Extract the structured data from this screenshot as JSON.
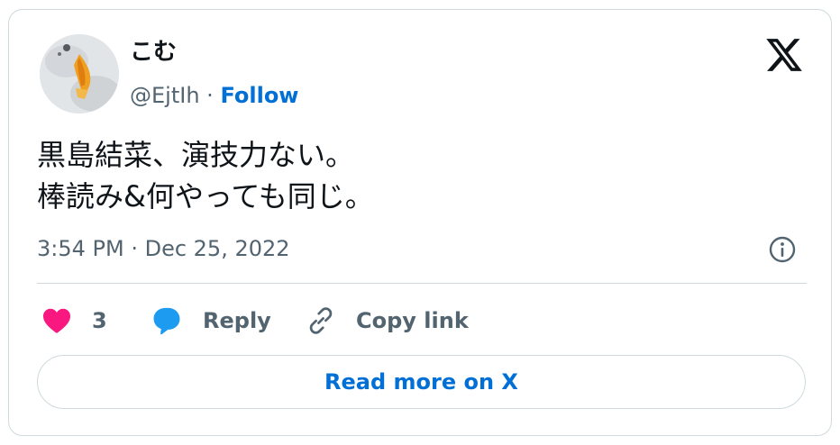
{
  "author": {
    "display_name": "こむ",
    "handle": "@EjtIh",
    "separator": "·",
    "follow_label": "Follow"
  },
  "tweet": {
    "lines": [
      "黒島結菜、演技力ない。",
      "棒読み&何やっても同じ。"
    ],
    "timestamp": "3:54 PM · Dec 25, 2022"
  },
  "actions": {
    "like_count": "3",
    "reply_label": "Reply",
    "copy_link_label": "Copy link"
  },
  "read_more_label": "Read more on X",
  "icons": {
    "brand": "x-logo-icon",
    "info": "info-icon",
    "like": "heart-icon",
    "reply": "speech-bubble-icon",
    "copy": "link-icon"
  },
  "colors": {
    "link_blue": "#006fd6",
    "heart_pink": "#f91880",
    "reply_blue": "#1d9bf0",
    "secondary_text": "#536471",
    "border": "#cfd9de"
  }
}
